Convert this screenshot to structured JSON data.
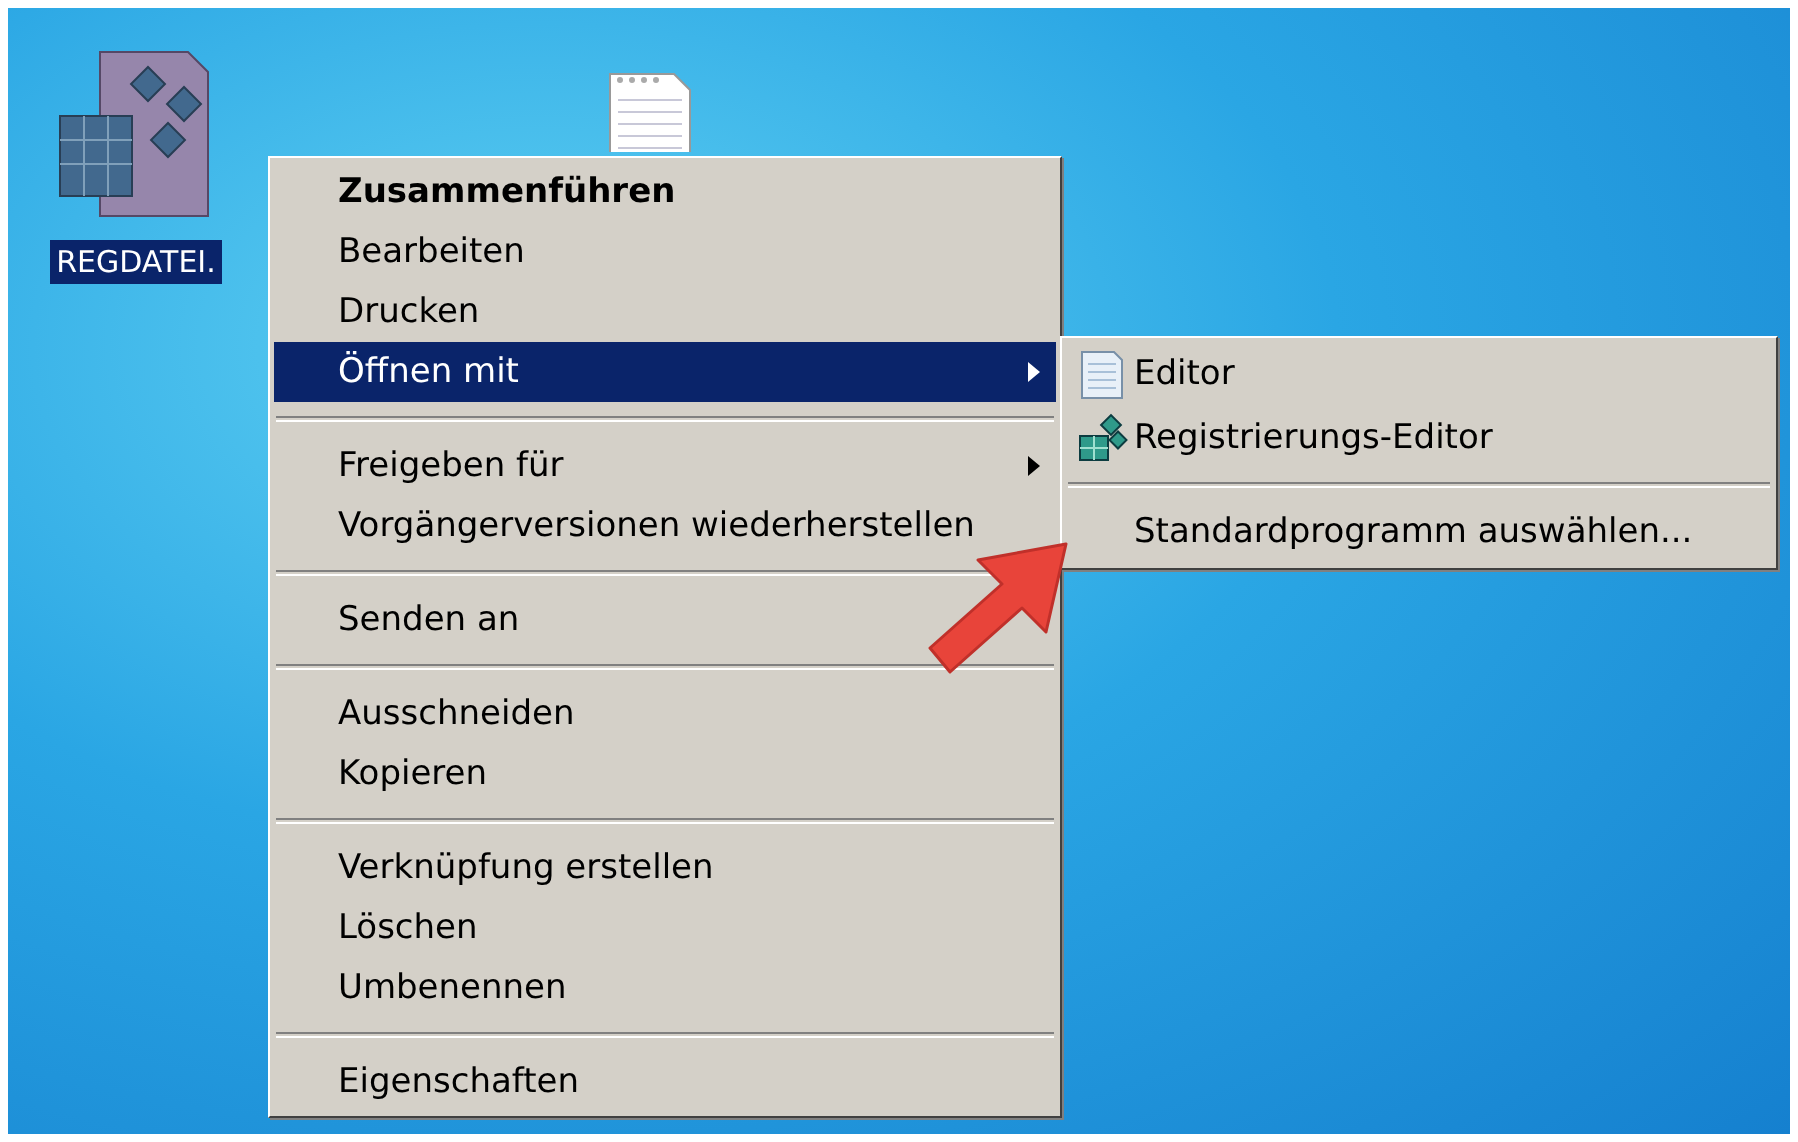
{
  "desktop_icons": [
    {
      "kind": "registry-file",
      "label": "REGDATEI.",
      "selected": true
    },
    {
      "kind": "text-file"
    }
  ],
  "context_menu": {
    "items": [
      {
        "kind": "item",
        "label": "Zusammenführen",
        "default": true,
        "selected": false,
        "has_submenu": false
      },
      {
        "kind": "item",
        "label": "Bearbeiten",
        "default": false,
        "selected": false,
        "has_submenu": false
      },
      {
        "kind": "item",
        "label": "Drucken",
        "default": false,
        "selected": false,
        "has_submenu": false
      },
      {
        "kind": "item",
        "label": "Öffnen mit",
        "default": false,
        "selected": true,
        "has_submenu": true
      },
      {
        "kind": "separator"
      },
      {
        "kind": "item",
        "label": "Freigeben für",
        "default": false,
        "selected": false,
        "has_submenu": true
      },
      {
        "kind": "item",
        "label": "Vorgängerversionen wiederherstellen",
        "default": false,
        "selected": false,
        "has_submenu": false
      },
      {
        "kind": "separator"
      },
      {
        "kind": "item",
        "label": "Senden an",
        "default": false,
        "selected": false,
        "has_submenu": false
      },
      {
        "kind": "separator"
      },
      {
        "kind": "item",
        "label": "Ausschneiden",
        "default": false,
        "selected": false,
        "has_submenu": false
      },
      {
        "kind": "item",
        "label": "Kopieren",
        "default": false,
        "selected": false,
        "has_submenu": false
      },
      {
        "kind": "separator"
      },
      {
        "kind": "item",
        "label": "Verknüpfung erstellen",
        "default": false,
        "selected": false,
        "has_submenu": false
      },
      {
        "kind": "item",
        "label": "Löschen",
        "default": false,
        "selected": false,
        "has_submenu": false
      },
      {
        "kind": "item",
        "label": "Umbenennen",
        "default": false,
        "selected": false,
        "has_submenu": false
      },
      {
        "kind": "separator"
      },
      {
        "kind": "item",
        "label": "Eigenschaften",
        "default": false,
        "selected": false,
        "has_submenu": false
      }
    ]
  },
  "open_with_submenu": {
    "items": [
      {
        "kind": "notepad-program",
        "label": "Editor",
        "selected": false
      },
      {
        "kind": "registry-program",
        "label": "Registrierungs-Editor",
        "selected": false
      },
      {
        "kind": "separator"
      },
      {
        "kind": "item",
        "label": "Standardprogramm auswählen...",
        "selected": false
      }
    ]
  },
  "annotation": {
    "kind": "arrow"
  }
}
